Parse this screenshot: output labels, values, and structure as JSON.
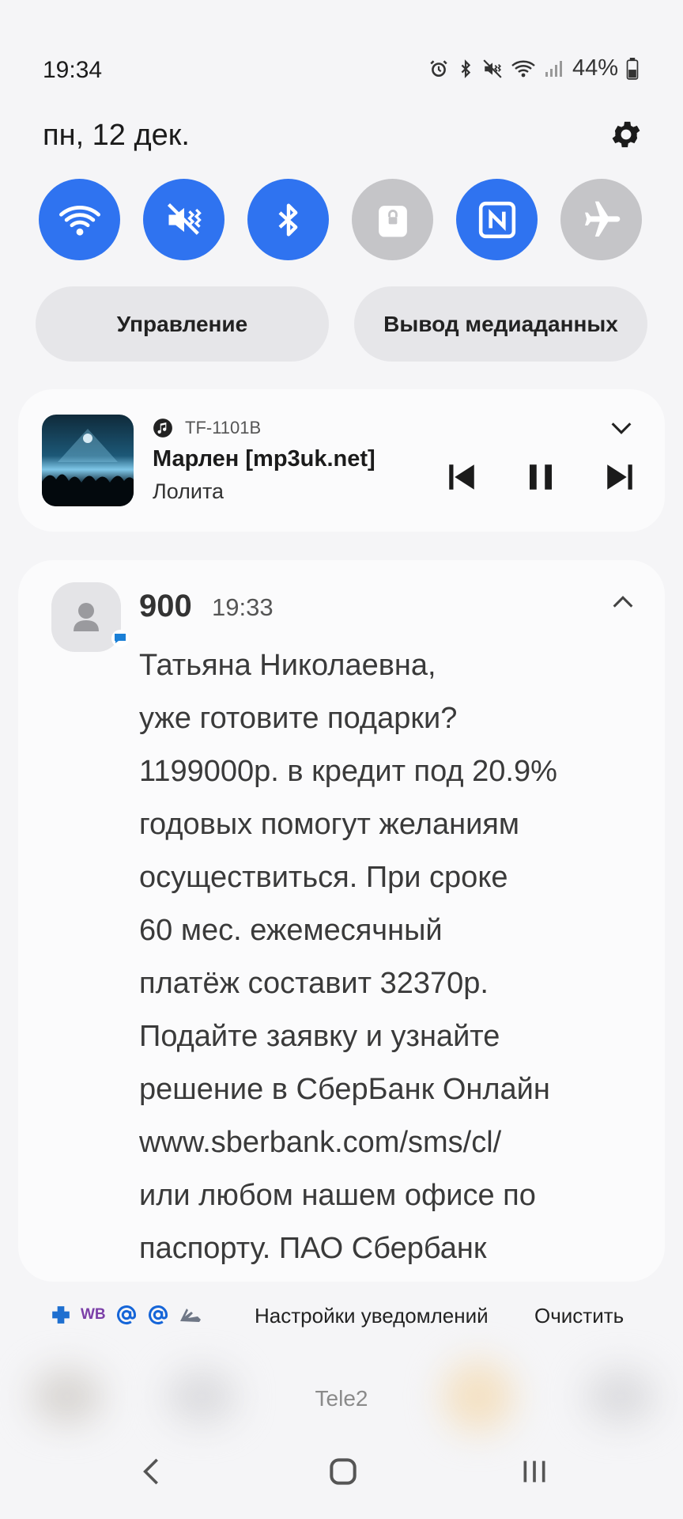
{
  "status_bar": {
    "time": "19:34",
    "battery_percent": "44%",
    "icons": [
      "alarm-icon",
      "bluetooth-icon",
      "vibrate-icon",
      "wifi-icon",
      "signal-icon",
      "battery-icon"
    ]
  },
  "header": {
    "date": "пн, 12 дек."
  },
  "quick_settings": {
    "tiles": [
      {
        "name": "wifi",
        "icon": "wifi-icon",
        "active": true
      },
      {
        "name": "sound",
        "icon": "mute-vibrate-icon",
        "active": true
      },
      {
        "name": "bluetooth",
        "icon": "bluetooth-icon",
        "active": true
      },
      {
        "name": "lock",
        "icon": "lock-icon",
        "active": false
      },
      {
        "name": "nfc",
        "icon": "nfc-icon",
        "active": true
      },
      {
        "name": "airplane",
        "icon": "airplane-icon",
        "active": false
      }
    ],
    "control_label": "Управление",
    "media_output_label": "Вывод медиаданных"
  },
  "media": {
    "device": "TF-1101B",
    "title": "Марлен [mp3uk.net]",
    "artist": "Лолита"
  },
  "notification": {
    "sender": "900",
    "time": "19:33",
    "body_lines": [
      "Татьяна Николаевна,",
      "уже готовите подарки?",
      "1199000р. в кредит под 20.9%",
      "годовых помогут желаниям",
      "осуществиться. При сроке",
      "60 мес. ежемесячный",
      "платёж составит 32370р.",
      "Подайте заявку и узнайте",
      "решение в СберБанк Онлайн",
      "www.sberbank.com/sms/cl/",
      "или любом нашем офисе по",
      "паспорту. ПАО Сбербанк"
    ]
  },
  "footer": {
    "app_icons": [
      "health-plus-icon",
      "wb-icon",
      "mail-at-icon",
      "mail-at-icon",
      "shoe-icon"
    ],
    "wb_text": "WB",
    "settings_label": "Настройки уведомлений",
    "clear_label": "Очистить"
  },
  "carrier": "Tele2",
  "colors": {
    "accent": "#2f73f0",
    "tile_off": "#c5c5c8",
    "background": "#f5f5f7",
    "card": "#fbfbfc"
  }
}
